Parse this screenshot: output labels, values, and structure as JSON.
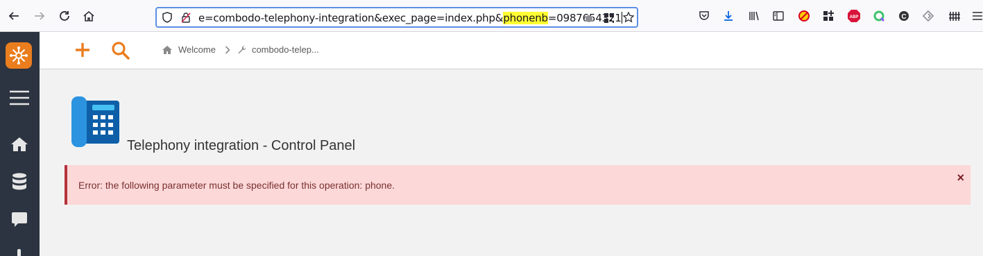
{
  "browser": {
    "url_before": "e=combodo-telephony-integration&exec_page=index.php&",
    "url_highlight": "phonenb",
    "url_after": "=0987654321"
  },
  "breadcrumb": {
    "home": "Welcome",
    "current": "combodo-telep..."
  },
  "page": {
    "title": "Telephony integration - Control Panel"
  },
  "alert": {
    "message": "Error: the following parameter must be specified for this operation: phone.",
    "close": "×"
  },
  "colors": {
    "accent": "#ea7d1e",
    "nav_bg": "#2c3441",
    "alert_bg": "#fcd8d8",
    "alert_border": "#b4323c"
  }
}
